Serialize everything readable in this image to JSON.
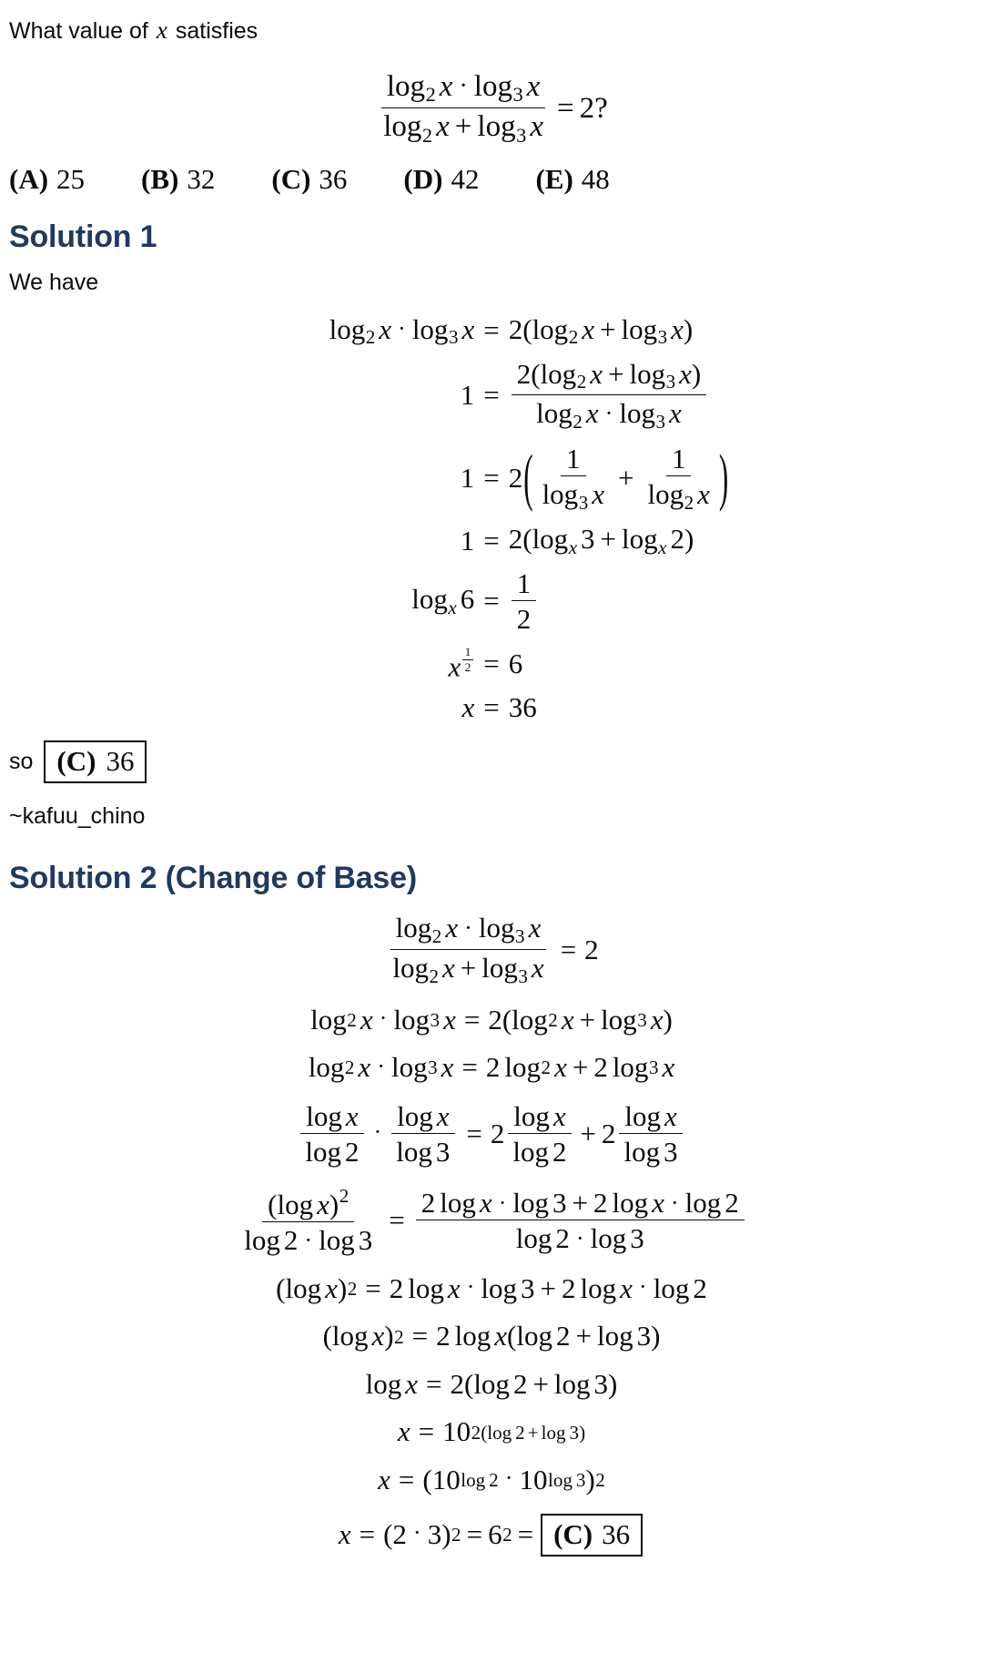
{
  "document": {
    "type": "math-solution-article",
    "accent_color": "#1f3a5f",
    "text_color": "#0b0b0b",
    "background_color": "#ffffff"
  },
  "problem": {
    "prompt_prefix": "What value of",
    "prompt_variable": "x",
    "prompt_suffix": "satisfies",
    "equation": {
      "numerator_left": "log",
      "numerator_left_base": "2",
      "numerator_left_arg": "x",
      "dot": "·",
      "numerator_right": "log",
      "numerator_right_base": "3",
      "numerator_right_arg": "x",
      "denominator_left": "log",
      "denominator_left_base": "2",
      "denominator_left_arg": "x",
      "plus": "+",
      "denominator_right": "log",
      "denominator_right_base": "3",
      "denominator_right_arg": "x",
      "relation": "=",
      "rhs": "2?",
      "latex": "\\frac{\\log_2 x \\cdot \\log_3 x}{\\log_2 x + \\log_3 x} = 2?"
    },
    "choices": [
      {
        "label": "(A)",
        "value": "25"
      },
      {
        "label": "(B)",
        "value": "32"
      },
      {
        "label": "(C)",
        "value": "36"
      },
      {
        "label": "(D)",
        "value": "42"
      },
      {
        "label": "(E)",
        "value": "48"
      }
    ],
    "correct_choice_label": "(C)",
    "correct_choice_value": "36"
  },
  "solution1": {
    "heading": "Solution 1",
    "intro": "We have",
    "steps": [
      {
        "latex": "\\log_2 x \\cdot \\log_3 x = 2(\\log_2 x + \\log_3 x)"
      },
      {
        "latex": "1 = \\frac{2(\\log_2 x + \\log_3 x)}{\\log_2 x \\cdot \\log_3 x}"
      },
      {
        "latex": "1 = 2(\\frac{1}{\\log_3 x} + \\frac{1}{\\log_2 x})"
      },
      {
        "latex": "1 = 2(\\log_x 3 + \\log_x 2)"
      },
      {
        "latex": "\\log_x 6 = \\frac{1}{2}"
      },
      {
        "latex": "x^{\\frac{1}{2}} = 6"
      },
      {
        "latex": "x = 36"
      }
    ],
    "conclusion_word": "so",
    "boxed_label": "(C)",
    "boxed_value": "36",
    "attribution": "~kafuu_chino",
    "tokens": {
      "log": "log",
      "one": "1",
      "two": "2",
      "three": "3",
      "six": "6",
      "x": "x",
      "thirtysix": "36",
      "eq": "=",
      "plus": "+",
      "dot": "·",
      "lparen": "(",
      "rparen": ")"
    }
  },
  "solution2": {
    "heading": "Solution 2 (Change of Base)",
    "steps": [
      {
        "latex": "\\frac{\\log_2 x \\cdot \\log_3 x}{\\log_2 x + \\log_3 x} = 2"
      },
      {
        "latex": "\\log_2 x \\cdot \\log_3 x = 2(\\log_2 x + \\log_3 x)"
      },
      {
        "latex": "\\log_2 x \\cdot \\log_3 x = 2\\log_2 x + 2\\log_3 x"
      },
      {
        "latex": "\\frac{\\log x}{\\log 2} \\cdot \\frac{\\log x}{\\log 3} = 2\\frac{\\log x}{\\log 2} + 2\\frac{\\log x}{\\log 3}"
      },
      {
        "latex": "\\frac{(\\log x)^2}{\\log 2 \\cdot \\log 3} = \\frac{2\\log x \\cdot \\log 3 + 2\\log x \\cdot \\log 2}{\\log 2 \\cdot \\log 3}"
      },
      {
        "latex": "(\\log x)^2 = 2\\log x \\cdot \\log 3 + 2\\log x \\cdot \\log 2"
      },
      {
        "latex": "(\\log x)^2 = 2\\log x(\\log 2 + \\log 3)"
      },
      {
        "latex": "\\log x = 2(\\log 2 + \\log 3)"
      },
      {
        "latex": "x = 10^{2(\\log 2 + \\log 3)}"
      },
      {
        "latex": "x = (10^{\\log 2} \\cdot 10^{\\log 3})^2"
      },
      {
        "latex": "x = (2 \\cdot 3)^2 = 6^2 = \\boxed{(C)\\ 36}"
      }
    ],
    "boxed_label": "(C)",
    "boxed_value": "36",
    "tokens": {
      "log": "log",
      "two": "2",
      "three": "3",
      "six": "6",
      "ten": "10",
      "x": "x",
      "eq": "=",
      "plus": "+",
      "dot": "·",
      "sq": "2"
    }
  }
}
